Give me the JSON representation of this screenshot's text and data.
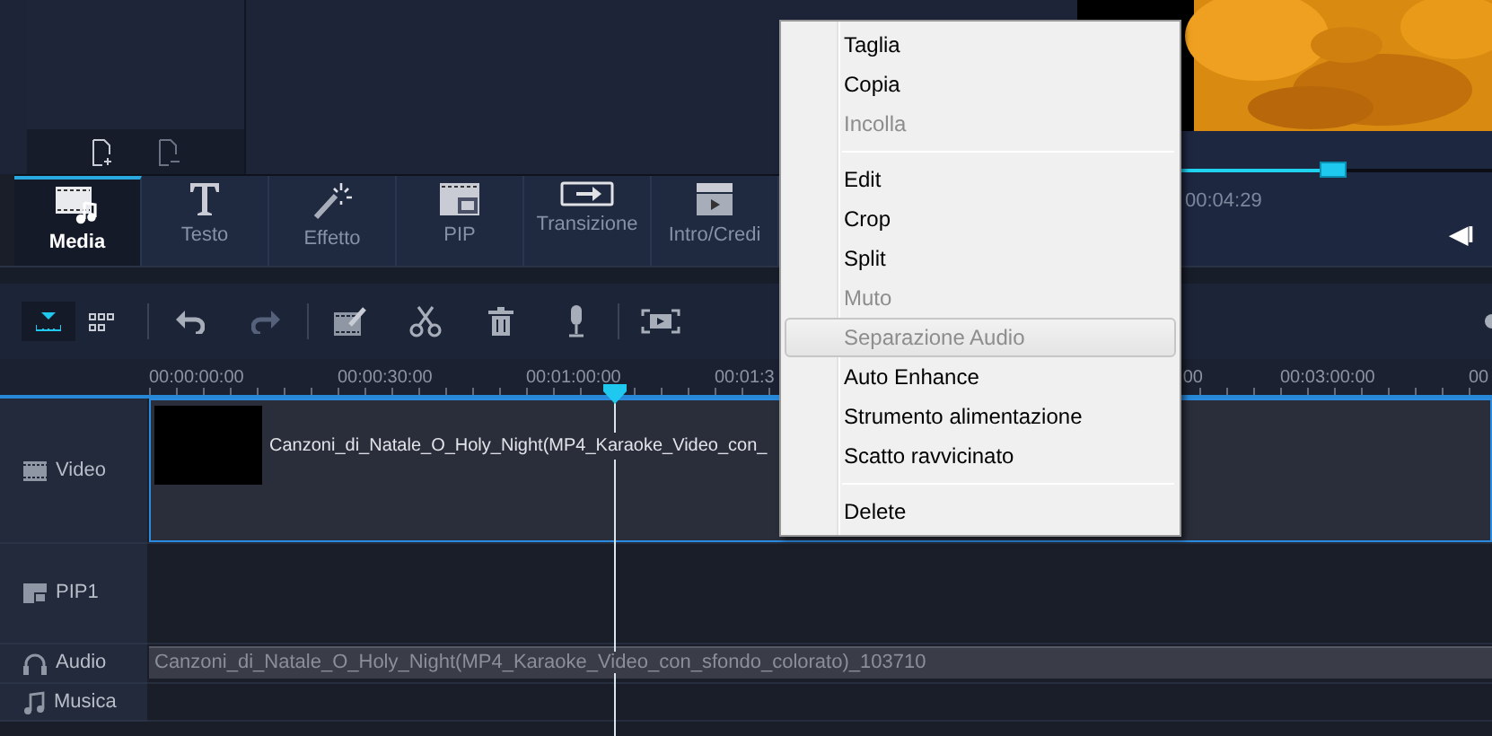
{
  "preview": {
    "kind": "picture",
    "level": 0.5,
    "time": "00:04:29",
    "button": "◀I"
  },
  "tabs": [
    {
      "label": "Media",
      "kind": "media",
      "selected": true
    },
    {
      "label": "Testo",
      "kind": "text",
      "selected": false
    },
    {
      "label": "Effetto",
      "kind": "effect",
      "selected": false
    },
    {
      "label": "PIP",
      "kind": "pip",
      "selected": false
    },
    {
      "label": "Transizione",
      "kind": "transition",
      "selected": false
    },
    {
      "label": "Intro/Credi",
      "kind": "intro",
      "selected": false
    }
  ],
  "view_toggle": [
    {
      "kind": "timeline",
      "selected": true
    },
    {
      "kind": "storyboard",
      "selected": false
    }
  ],
  "ruler": [
    {
      "label": "00:00:00:00"
    },
    {
      "label": "00:00:30:00"
    },
    {
      "label": "00:01:00:00"
    },
    {
      "label": "00:01:3"
    },
    {
      "kind": "hidden"
    },
    {
      "label": "00",
      "kind": "tail"
    },
    {
      "label": "00:03:00:00"
    },
    {
      "label": "00"
    }
  ],
  "tracks": [
    {
      "label": "Video",
      "kind": "video",
      "clip": "Canzoni_di_Natale_O_Holy_Night(MP4_Karaoke_Video_con_"
    },
    {
      "label": "PIP1",
      "kind": "pip"
    },
    {
      "label": "Audio",
      "kind": "audio",
      "clip": "Canzoni_di_Natale_O_Holy_Night(MP4_Karaoke_Video_con_sfondo_colorato)_103710"
    },
    {
      "label": "Musica",
      "kind": "music"
    }
  ],
  "context_menu": [
    {
      "kind": "item",
      "label": "Taglia",
      "disabled": false,
      "selected": false
    },
    {
      "kind": "item",
      "label": "Copia",
      "disabled": false,
      "selected": false
    },
    {
      "kind": "item",
      "label": "Incolla",
      "disabled": true,
      "selected": false
    },
    {
      "kind": "separator"
    },
    {
      "kind": "item",
      "label": "Edit",
      "disabled": false,
      "selected": false
    },
    {
      "kind": "item",
      "label": "Crop",
      "disabled": false,
      "selected": false
    },
    {
      "kind": "item",
      "label": "Split",
      "disabled": false,
      "selected": false
    },
    {
      "kind": "item",
      "label": "Muto",
      "disabled": true,
      "selected": false
    },
    {
      "kind": "item",
      "label": "Separazione Audio",
      "disabled": true,
      "selected": true
    },
    {
      "kind": "item",
      "label": "Auto Enhance",
      "disabled": false,
      "selected": false
    },
    {
      "kind": "item",
      "label": "Strumento alimentazione",
      "disabled": false,
      "selected": false
    },
    {
      "kind": "item",
      "label": "Scatto ravvicinato",
      "disabled": false,
      "selected": false
    },
    {
      "kind": "separator"
    },
    {
      "kind": "item",
      "label": "Delete",
      "disabled": false,
      "selected": false
    }
  ]
}
